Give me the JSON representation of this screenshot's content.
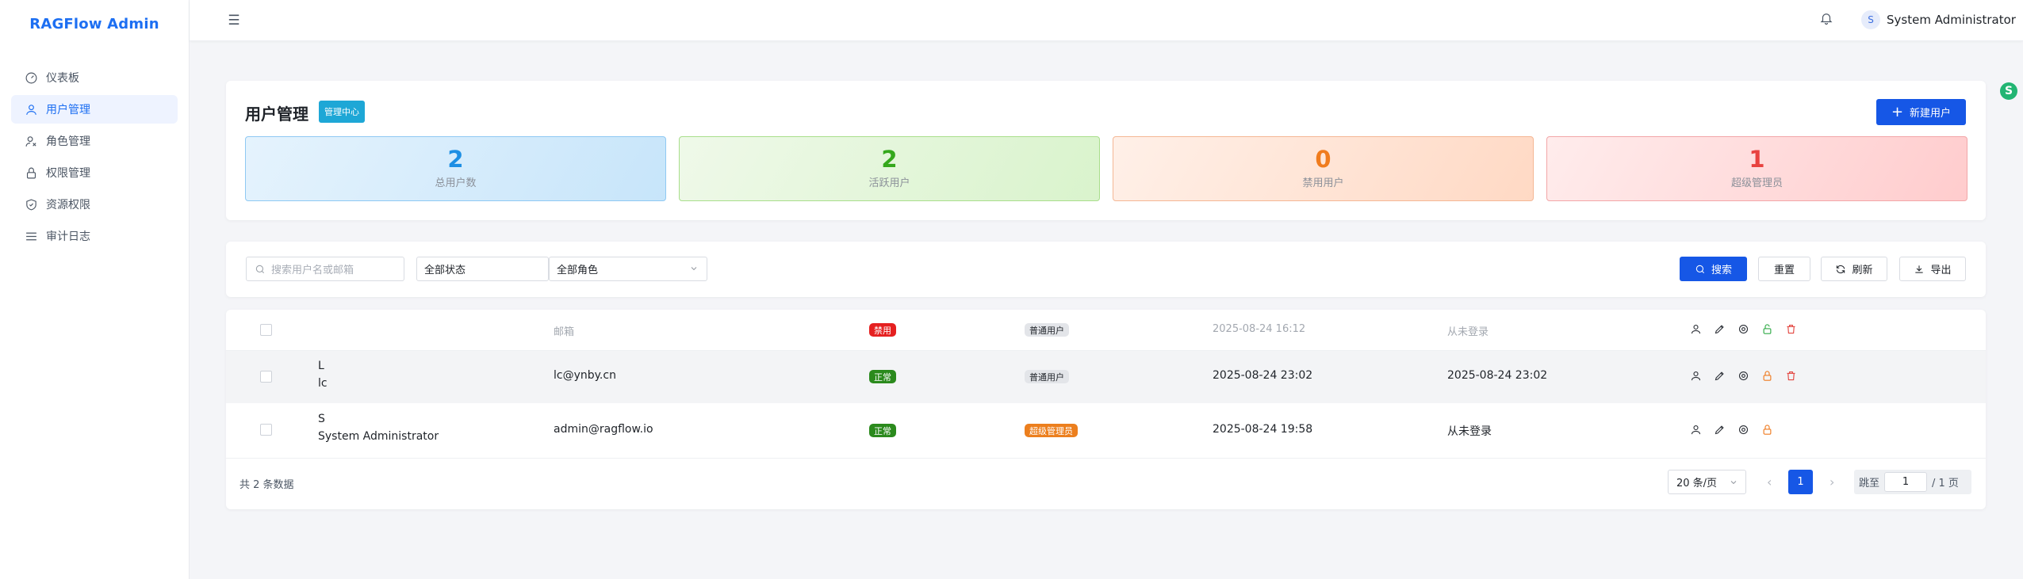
{
  "sidebar": {
    "brand": "RAGFlow Admin",
    "items": [
      {
        "label": "仪表板",
        "icon": "dashboard-icon",
        "active": false
      },
      {
        "label": "用户管理",
        "icon": "user-icon",
        "active": true
      },
      {
        "label": "角色管理",
        "icon": "role-icon",
        "active": false
      },
      {
        "label": "权限管理",
        "icon": "lock-icon",
        "active": false
      },
      {
        "label": "资源权限",
        "icon": "shield-check-icon",
        "active": false
      },
      {
        "label": "审计日志",
        "icon": "list-icon",
        "active": false
      }
    ]
  },
  "header": {
    "menu_icon": "hamburger-icon",
    "bell_icon": "bell-icon",
    "avatar_letter": "S",
    "user_name": "System Administrator"
  },
  "main": {
    "title": "用户管理",
    "title_badge": "管理中心",
    "new_button": "新建用户",
    "stats": [
      {
        "value": "2",
        "label": "总用户数",
        "color": "#1d8fe4"
      },
      {
        "value": "2",
        "label": "活跃用户",
        "color": "#35a81c"
      },
      {
        "value": "0",
        "label": "禁用用户",
        "color": "#f07c1e"
      },
      {
        "value": "1",
        "label": "超级管理员",
        "color": "#e8423f"
      }
    ]
  },
  "filters": {
    "search_placeholder": "搜索用户名或邮箱",
    "status_value": "全部状态",
    "role_value": "全部角色",
    "search_button": "搜索",
    "reset_button": "重置",
    "refresh_button": "刷新",
    "export_button": "导出"
  },
  "table": {
    "header": {
      "email": "邮箱",
      "status": "禁用",
      "role": "普通用户",
      "created": "2025-08-24 16:12",
      "last_login": "从未登录"
    },
    "rows": [
      {
        "name_line1": "L",
        "name_line2": "lc",
        "email": "lc@ynby.cn",
        "status": "正常",
        "role": "普通用户",
        "created": "2025-08-24 23:02",
        "last_login": "2025-08-24 23:02"
      },
      {
        "name_line1": "S",
        "name_line2": "System Administrator",
        "email": "admin@ragflow.io",
        "status": "正常",
        "role": "超级管理员",
        "created": "2025-08-24 19:58",
        "last_login": "从未登录"
      }
    ]
  },
  "pagination": {
    "total_text": "共 2 条数据",
    "page_size": "20 条/页",
    "current_page": "1",
    "jump_label": "跳至",
    "jump_value": "1",
    "pages_text": "/ 1 页",
    "prev_icon": "chevron-left-icon",
    "next_icon": "chevron-right-icon"
  },
  "colors": {
    "primary": "#1657e6",
    "brand": "#1d6ff2",
    "danger": "#e52020",
    "success": "#2b8a1d",
    "warning": "#ec7f1e"
  }
}
